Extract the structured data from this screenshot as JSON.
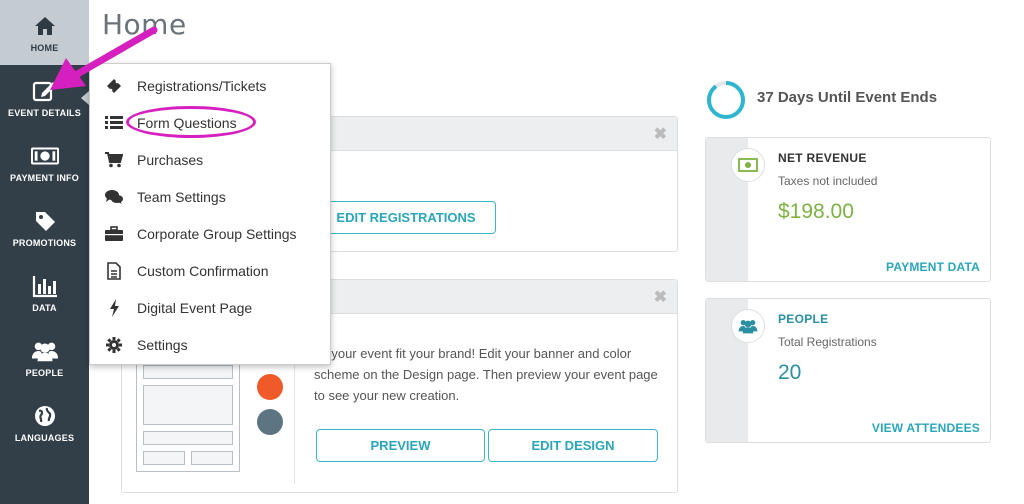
{
  "page": {
    "title": "Home"
  },
  "colors": {
    "sidebar": "#333f48",
    "accent": "#2aa6bb",
    "revenue": "#7cb342",
    "annotation": "#d61fbf"
  },
  "sidebar": {
    "items": [
      {
        "label": "HOME",
        "icon": "home-icon",
        "active": true
      },
      {
        "label": "EVENT DETAILS",
        "icon": "edit-icon"
      },
      {
        "label": "PAYMENT INFO",
        "icon": "money-icon"
      },
      {
        "label": "PROMOTIONS",
        "icon": "tag-icon"
      },
      {
        "label": "DATA",
        "icon": "bar-chart-icon"
      },
      {
        "label": "PEOPLE",
        "icon": "people-icon"
      },
      {
        "label": "LANGUAGES",
        "icon": "globe-icon"
      }
    ]
  },
  "menu": {
    "items": [
      {
        "label": "Registrations/Tickets",
        "icon": "ticket-icon"
      },
      {
        "label": "Form Questions",
        "icon": "list-icon"
      },
      {
        "label": "Purchases",
        "icon": "cart-icon"
      },
      {
        "label": "Team Settings",
        "icon": "chat-icon"
      },
      {
        "label": "Corporate Group Settings",
        "icon": "briefcase-icon"
      },
      {
        "label": "Custom Confirmation",
        "icon": "document-icon"
      },
      {
        "label": "Digital Event Page",
        "icon": "bolt-icon"
      },
      {
        "label": "Settings",
        "icon": "gear-icon"
      }
    ]
  },
  "registrations_card": {
    "button": "EDIT REGISTRATIONS"
  },
  "design_card": {
    "text": "ke your event fit your brand! Edit your banner and color scheme on the Design page. Then preview your event page to see your new creation.",
    "preview_button": "PREVIEW",
    "edit_button": "EDIT DESIGN"
  },
  "countdown": {
    "text": "37 Days Until Event Ends"
  },
  "revenue": {
    "title": "NET REVENUE",
    "subtitle": "Taxes not included",
    "value": "$198.00",
    "link": "PAYMENT DATA"
  },
  "people": {
    "title": "PEOPLE",
    "subtitle": "Total Registrations",
    "value": "20",
    "link": "VIEW ATTENDEES"
  }
}
